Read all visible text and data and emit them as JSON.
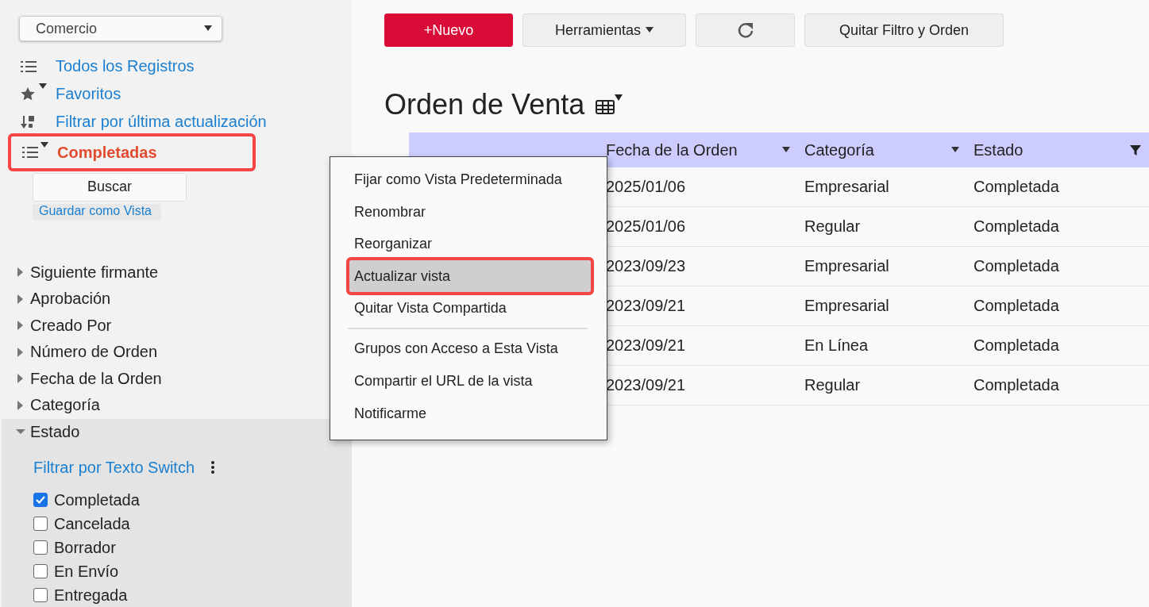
{
  "sidebar": {
    "app_select": {
      "value": "Comercio"
    },
    "views": [
      {
        "label": "Todos los Registros",
        "selected": false
      },
      {
        "label": "Favoritos",
        "selected": false
      },
      {
        "label": "Filtrar por última actualización",
        "selected": false
      },
      {
        "label": "Completadas",
        "selected": true
      }
    ],
    "search_button": "Buscar",
    "save_view_link": "Guardar como Vista",
    "filters": [
      {
        "label": "Siguiente firmante",
        "expanded": false
      },
      {
        "label": "Aprobación",
        "expanded": false
      },
      {
        "label": "Creado Por",
        "expanded": false
      },
      {
        "label": "Número de Orden",
        "expanded": false
      },
      {
        "label": "Fecha de la Orden",
        "expanded": false
      },
      {
        "label": "Categoría",
        "expanded": false
      },
      {
        "label": "Estado",
        "expanded": true,
        "link": "Filtrar por Texto Switch",
        "options": [
          {
            "label": "Completada",
            "checked": true
          },
          {
            "label": "Cancelada",
            "checked": false
          },
          {
            "label": "Borrador",
            "checked": false
          },
          {
            "label": "En Envío",
            "checked": false
          },
          {
            "label": "Entregada",
            "checked": false
          }
        ]
      }
    ]
  },
  "toolbar": {
    "new_button": "+Nuevo",
    "tools_button": "Herramientas",
    "clear_button": "Quitar Filtro y Orden"
  },
  "title": "Orden de Venta",
  "table": {
    "columns": [
      {
        "label": "Fecha de la Orden",
        "filtered": false
      },
      {
        "label": "Categoría",
        "filtered": false
      },
      {
        "label": "Estado",
        "filtered": true
      }
    ],
    "rows": [
      [
        "2025/01/06",
        "Empresarial",
        "Completada"
      ],
      [
        "2025/01/06",
        "Regular",
        "Completada"
      ],
      [
        "2023/09/23",
        "Empresarial",
        "Completada"
      ],
      [
        "2023/09/21",
        "Empresarial",
        "Completada"
      ],
      [
        "2023/09/21",
        "En Línea",
        "Completada"
      ],
      [
        "2023/09/21",
        "Regular",
        "Completada"
      ]
    ]
  },
  "context_menu": {
    "items": [
      {
        "label": "Fijar como Vista Predeterminada",
        "selected": false
      },
      {
        "label": "Renombrar",
        "selected": false
      },
      {
        "label": "Reorganizar",
        "selected": false
      },
      {
        "label": "Actualizar vista",
        "selected": true
      },
      {
        "label": "Quitar Vista Compartida",
        "selected": false
      },
      {
        "kind": "separator"
      },
      {
        "label": "Grupos con Acceso a Esta Vista",
        "selected": false
      },
      {
        "label": "Compartir el URL de la vista",
        "selected": false
      },
      {
        "label": "Notificarme",
        "selected": false
      }
    ]
  }
}
